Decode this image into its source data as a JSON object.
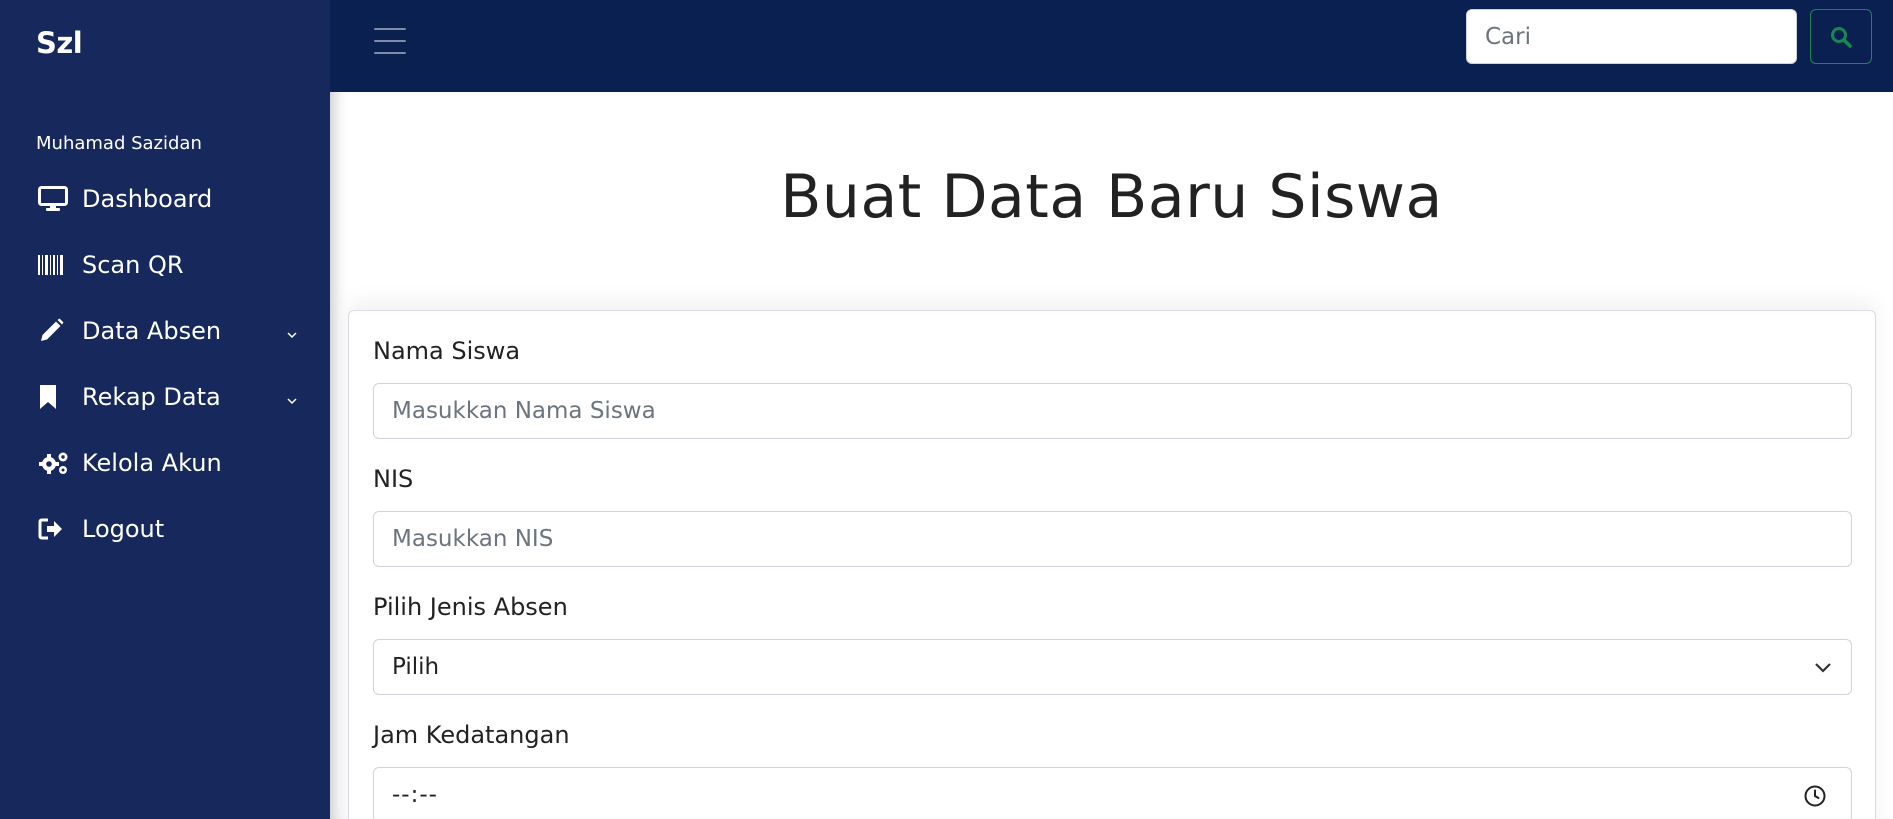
{
  "sidebar": {
    "brand": "Szl",
    "username": "Muhamad Sazidan",
    "items": [
      {
        "label": "Dashboard",
        "icon": "monitor-icon",
        "has_caret": false
      },
      {
        "label": "Scan QR",
        "icon": "barcode-icon",
        "has_caret": false
      },
      {
        "label": "Data Absen",
        "icon": "pencil-icon",
        "has_caret": true
      },
      {
        "label": "Rekap Data",
        "icon": "bookmark-icon",
        "has_caret": true
      },
      {
        "label": "Kelola Akun",
        "icon": "gears-icon",
        "has_caret": false
      },
      {
        "label": "Logout",
        "icon": "logout-icon",
        "has_caret": false
      }
    ]
  },
  "topbar": {
    "search": {
      "placeholder": "Cari",
      "value": ""
    },
    "search_button_icon": "search-icon"
  },
  "main": {
    "title": "Buat Data Baru Siswa",
    "form": {
      "nama": {
        "label": "Nama Siswa",
        "placeholder": "Masukkan Nama Siswa",
        "value": ""
      },
      "nis": {
        "label": "NIS",
        "placeholder": "Masukkan NIS",
        "value": ""
      },
      "jenis": {
        "label": "Pilih Jenis Absen",
        "selected": "Pilih"
      },
      "jam": {
        "label": "Jam Kedatangan",
        "value": "--:--"
      }
    }
  },
  "colors": {
    "sidebar_bg": "#16285c",
    "topbar_bg": "#0a2050",
    "search_accent": "#198754"
  }
}
